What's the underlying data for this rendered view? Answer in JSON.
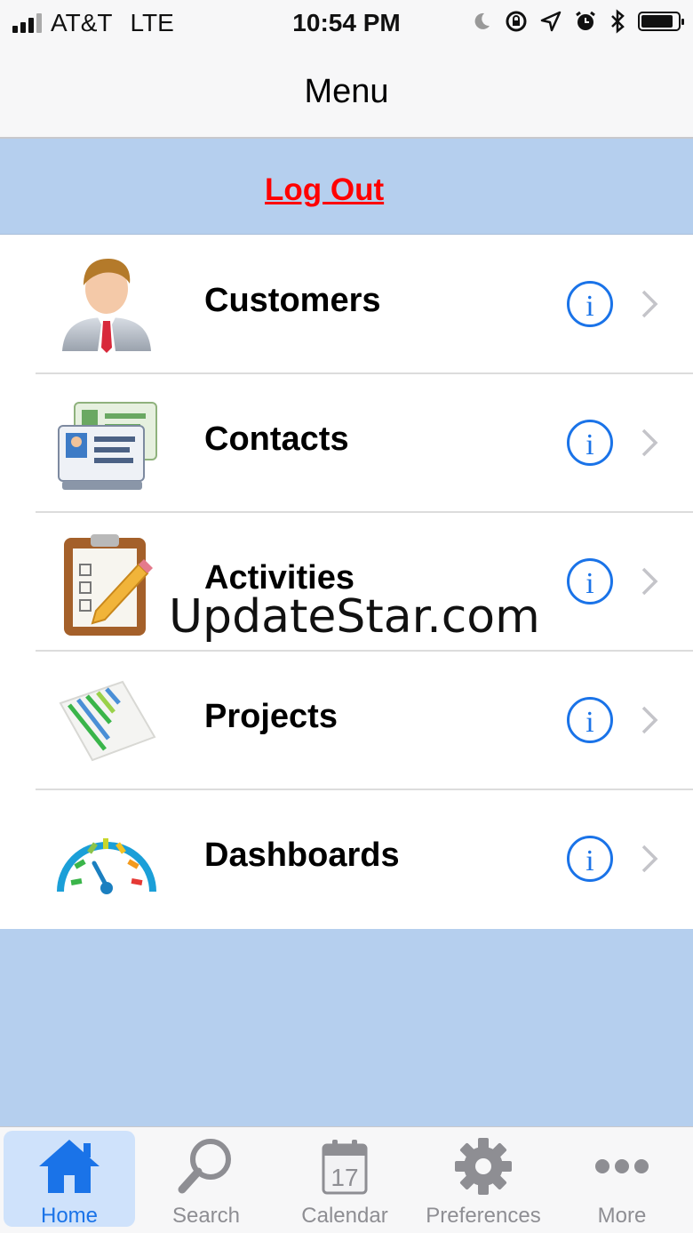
{
  "status_bar": {
    "carrier": "AT&T",
    "network": "LTE",
    "time": "10:54 PM"
  },
  "nav": {
    "title": "Menu"
  },
  "logout": {
    "label": "Log Out"
  },
  "menu": {
    "items": [
      {
        "label": "Customers",
        "icon": "customer-person-icon"
      },
      {
        "label": "Contacts",
        "icon": "contact-cards-icon"
      },
      {
        "label": "Activities",
        "icon": "clipboard-pencil-icon"
      },
      {
        "label": "Projects",
        "icon": "gantt-chart-icon"
      },
      {
        "label": "Dashboards",
        "icon": "speedometer-gauge-icon"
      }
    ]
  },
  "watermark": "UpdateStar.com",
  "tabbar": {
    "tabs": [
      {
        "label": "Home",
        "icon": "house-icon",
        "active": true
      },
      {
        "label": "Search",
        "icon": "magnifier-icon"
      },
      {
        "label": "Calendar",
        "icon": "calendar-icon",
        "date": "17"
      },
      {
        "label": "Preferences",
        "icon": "gear-icon"
      },
      {
        "label": "More",
        "icon": "ellipsis-icon"
      }
    ]
  },
  "colors": {
    "accent": "#1a73e8",
    "logout": "#ff0000",
    "band": "#b5cfee"
  }
}
